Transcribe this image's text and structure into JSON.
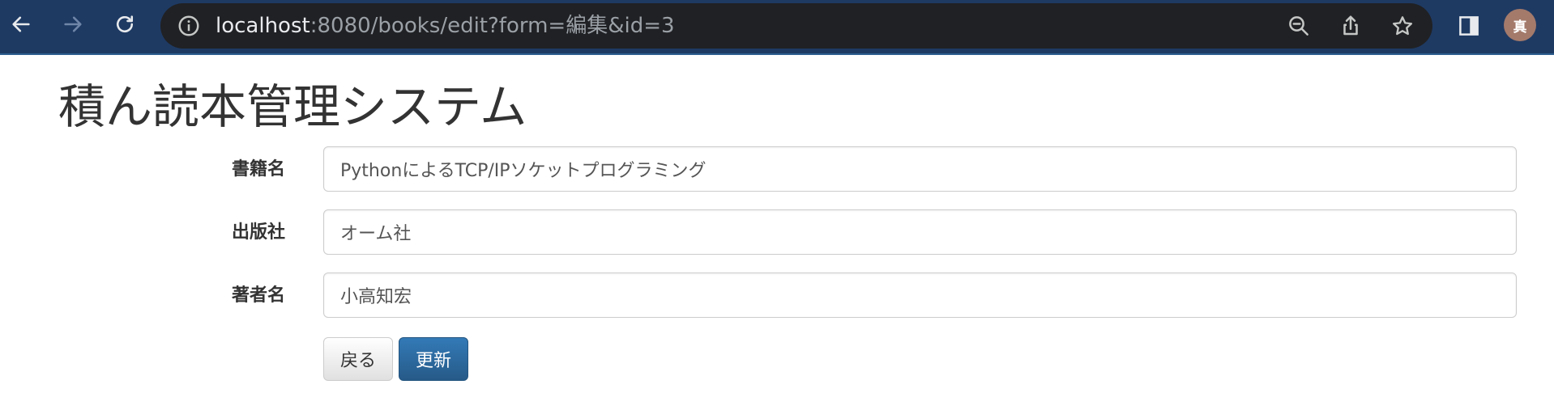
{
  "browser": {
    "url_host": "localhost",
    "url_rest": ":8080/books/edit?form=編集&id=3",
    "avatar_initial": "真",
    "icons": [
      "back-arrow-icon",
      "forward-arrow-icon",
      "reload-icon",
      "site-info-icon",
      "zoom-out-icon",
      "share-icon",
      "bookmark-star-icon",
      "side-panel-icon"
    ],
    "colors": {
      "toolbar": "#1e3a63",
      "urlbar": "#202124",
      "avatar": "#a47a6b"
    }
  },
  "page": {
    "title": "積ん読本管理システム"
  },
  "form": {
    "fields": [
      {
        "label": "書籍名",
        "value": "PythonによるTCP/IPソケットプログラミング"
      },
      {
        "label": "出版社",
        "value": "オーム社"
      },
      {
        "label": "著者名",
        "value": "小高知宏"
      }
    ],
    "back_label": "戻る",
    "update_label": "更新"
  },
  "colors": {
    "primary_button": "#337ab7",
    "text": "#333333"
  }
}
